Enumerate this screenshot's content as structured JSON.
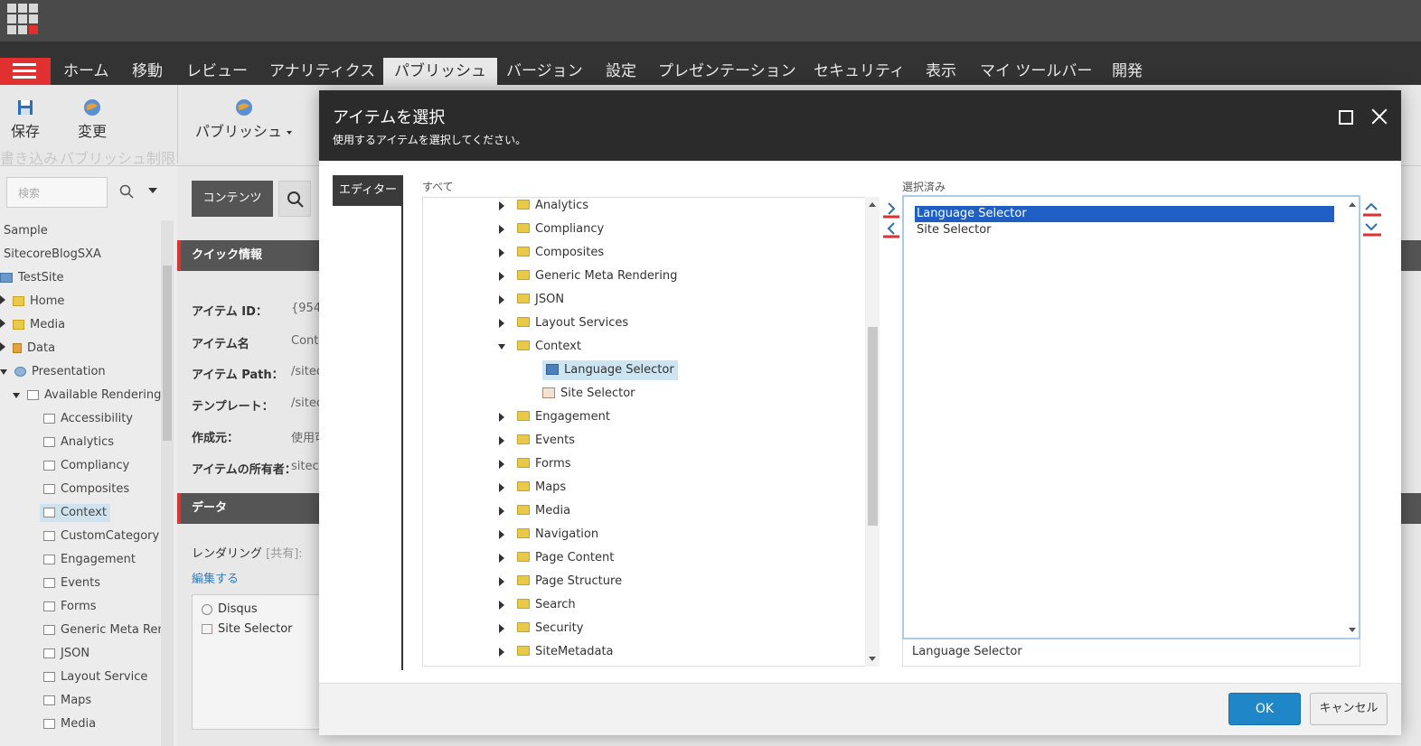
{
  "ribbon_tabs": [
    "ホーム",
    "移動",
    "レビュー",
    "アナリティクス",
    "パブリッシュ",
    "バージョン",
    "設定",
    "プレゼンテーション",
    "セキュリティ",
    "表示",
    "マイ ツールバー",
    "開発"
  ],
  "active_tab": "パブリッシュ",
  "ribbon": {
    "save_label": "保存",
    "change_label": "変更",
    "publish_label": "パブリッシュ",
    "group_write": "書き込み",
    "group_publish_limit": "パブリッシュ制限"
  },
  "left": {
    "search_placeholder": "検索",
    "tree": [
      "Sample",
      "SitecoreBlogSXA",
      "TestSite",
      "Home",
      "Media",
      "Data",
      "Presentation",
      "Available Renderings",
      "Accessibility",
      "Analytics",
      "Compliancy",
      "Composites",
      "Context",
      "CustomCategory",
      "Engagement",
      "Events",
      "Forms",
      "Generic Meta Rend",
      "JSON",
      "Layout Service",
      "Maps",
      "Media"
    ],
    "selected": "Context"
  },
  "content": {
    "tab_label": "コンテンツ",
    "quick_info": "クイック情報",
    "data_section": "データ",
    "fields": [
      {
        "label": "アイテム ID：",
        "value": "{954"
      },
      {
        "label": "アイテム名",
        "value": "Conte"
      },
      {
        "label": "アイテム Path：",
        "value": "/sitec"
      },
      {
        "label": "テンプレート：",
        "value": "/sitec"
      },
      {
        "label": "作成元：",
        "value": "使用可"
      },
      {
        "label": "アイテムの所有者：",
        "value": "sitecc"
      }
    ],
    "rendering_label": "レンダリング",
    "rendering_shared": "[共有]:",
    "edit_link": "編集する",
    "renderings": [
      "Disqus",
      "Site Selector"
    ]
  },
  "dialog": {
    "title": "アイテムを選択",
    "subtitle": "使用するアイテムを選択してください。",
    "editor_tab": "エディター",
    "all_label": "すべて",
    "selected_label": "選択済み",
    "tree": [
      {
        "label": "Analytics",
        "type": "folder",
        "expand": "collapsed",
        "indent": 0
      },
      {
        "label": "Compliancy",
        "type": "folder",
        "expand": "collapsed",
        "indent": 0
      },
      {
        "label": "Composites",
        "type": "folder",
        "expand": "collapsed",
        "indent": 0
      },
      {
        "label": "Generic Meta Rendering",
        "type": "folder",
        "expand": "collapsed",
        "indent": 0
      },
      {
        "label": "JSON",
        "type": "folder",
        "expand": "collapsed",
        "indent": 0
      },
      {
        "label": "Layout Services",
        "type": "folder",
        "expand": "collapsed",
        "indent": 0
      },
      {
        "label": "Context",
        "type": "folder",
        "expand": "expanded",
        "indent": 0
      },
      {
        "label": "Language Selector",
        "type": "item",
        "expand": "none",
        "indent": 1,
        "selected": true
      },
      {
        "label": "Site Selector",
        "type": "item2",
        "expand": "none",
        "indent": 1
      },
      {
        "label": "Engagement",
        "type": "folder",
        "expand": "collapsed",
        "indent": 0
      },
      {
        "label": "Events",
        "type": "folder",
        "expand": "collapsed",
        "indent": 0
      },
      {
        "label": "Forms",
        "type": "folder",
        "expand": "collapsed",
        "indent": 0
      },
      {
        "label": "Maps",
        "type": "folder",
        "expand": "collapsed",
        "indent": 0
      },
      {
        "label": "Media",
        "type": "folder",
        "expand": "collapsed",
        "indent": 0
      },
      {
        "label": "Navigation",
        "type": "folder",
        "expand": "collapsed",
        "indent": 0
      },
      {
        "label": "Page Content",
        "type": "folder",
        "expand": "collapsed",
        "indent": 0
      },
      {
        "label": "Page Structure",
        "type": "folder",
        "expand": "collapsed",
        "indent": 0
      },
      {
        "label": "Search",
        "type": "folder",
        "expand": "collapsed",
        "indent": 0
      },
      {
        "label": "Security",
        "type": "folder",
        "expand": "collapsed",
        "indent": 0
      },
      {
        "label": "SiteMetadata",
        "type": "folder",
        "expand": "collapsed",
        "indent": 0
      }
    ],
    "selected_items": [
      "Language Selector",
      "Site Selector"
    ],
    "active_selected": "Language Selector",
    "name_value": "Language Selector",
    "ok_label": "OK",
    "cancel_label": "キャンセル"
  },
  "colors": {
    "accent": "#e03030",
    "ok_button": "#1f86c7",
    "selection": "#1f5fc4"
  }
}
